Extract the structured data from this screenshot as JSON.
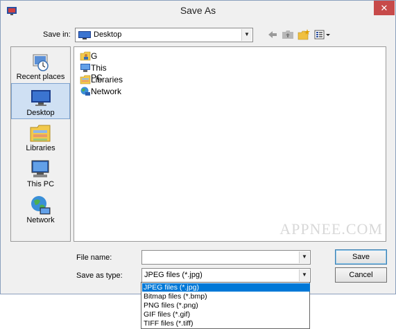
{
  "window": {
    "title": "Save As",
    "close_glyph": "✕"
  },
  "save_in": {
    "label": "Save in:",
    "value": "Desktop"
  },
  "places": [
    {
      "label": "Recent places",
      "icon": "recent-places-icon"
    },
    {
      "label": "Desktop",
      "icon": "desktop-icon",
      "selected": true
    },
    {
      "label": "Libraries",
      "icon": "libraries-icon"
    },
    {
      "label": "This PC",
      "icon": "this-pc-icon"
    },
    {
      "label": "Network",
      "icon": "network-icon"
    }
  ],
  "files": [
    {
      "label": "G",
      "icon": "user-folder-icon"
    },
    {
      "label": "This PC",
      "icon": "this-pc-icon"
    },
    {
      "label": "Libraries",
      "icon": "libraries-icon"
    },
    {
      "label": "Network",
      "icon": "network-icon"
    }
  ],
  "watermark": "APPNEE.COM",
  "file_name": {
    "label": "File name:",
    "value": ""
  },
  "save_as_type": {
    "label": "Save as type:",
    "value": "JPEG files (*.jpg)"
  },
  "buttons": {
    "save": "Save",
    "cancel": "Cancel"
  },
  "type_options": [
    "JPEG files (*.jpg)",
    "Bitmap files (*.bmp)",
    "PNG files (*.png)",
    "GIF files (*.gif)",
    "TIFF files (*.tiff)"
  ],
  "colors": {
    "selection": "#0078d7",
    "close": "#c74a4a"
  }
}
